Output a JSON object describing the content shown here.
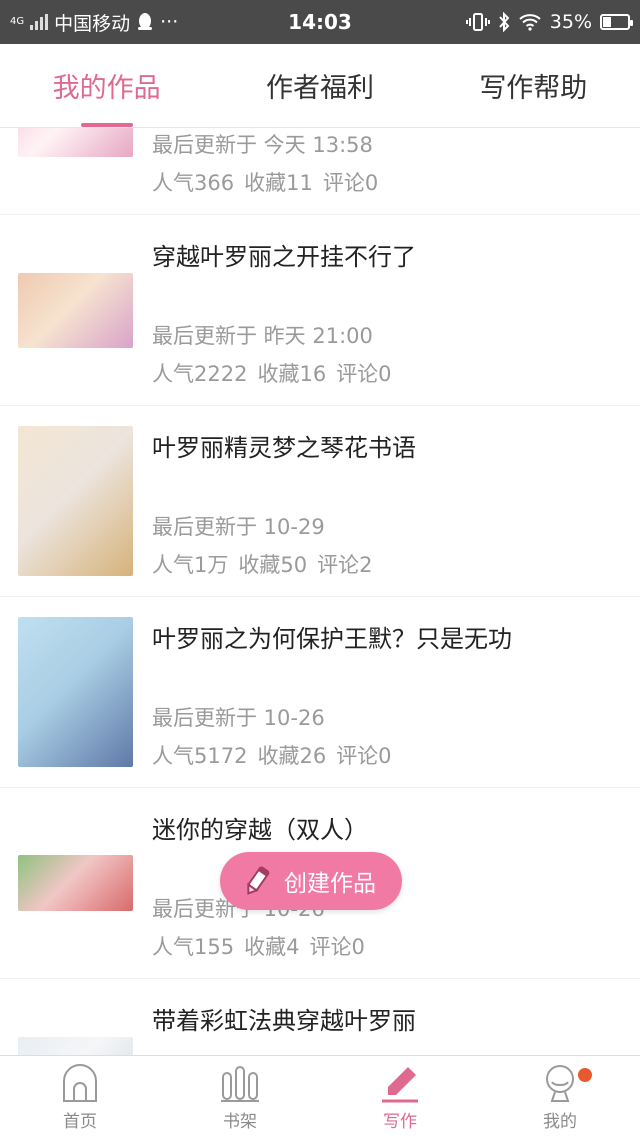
{
  "status_bar": {
    "network": "4G",
    "carrier": "中国移动",
    "more": "···",
    "time": "14:03",
    "battery": "35%",
    "battery_level": 0.35
  },
  "tabs": [
    {
      "label": "我的作品",
      "active": true
    },
    {
      "label": "作者福利",
      "active": false
    },
    {
      "label": "写作帮助",
      "active": false
    }
  ],
  "works": [
    {
      "title": "",
      "updated": "最后更新于 今天 13:58",
      "popularity": "人气366",
      "favorites": "收藏11",
      "comments": "评论0",
      "cover_colors": [
        "#f5c8d8",
        "#e7a7c2",
        "#fff3f6"
      ]
    },
    {
      "title": "穿越叶罗丽之开挂不行了",
      "updated": "最后更新于 昨天 21:00",
      "popularity": "人气2222",
      "favorites": "收藏16",
      "comments": "评论0",
      "cover_colors": [
        "#efc9b0",
        "#d9a3c9",
        "#f6e3cf"
      ]
    },
    {
      "title": "叶罗丽精灵梦之琴花书语",
      "updated": "最后更新于 10-29",
      "popularity": "人气1万",
      "favorites": "收藏50",
      "comments": "评论2",
      "cover_colors": [
        "#f3e6d2",
        "#d6b27a",
        "#ece4dd"
      ]
    },
    {
      "title": "叶罗丽之为何保护王默？只是无功",
      "updated": "最后更新于 10-26",
      "popularity": "人气5172",
      "favorites": "收藏26",
      "comments": "评论0",
      "cover_colors": [
        "#bfe0ef",
        "#5e79a8",
        "#a9cde4"
      ]
    },
    {
      "title": "迷你的穿越（双人）",
      "updated": "最后更新于 10-26",
      "popularity": "人气155",
      "favorites": "收藏4",
      "comments": "评论0",
      "cover_colors": [
        "#8fc27f",
        "#d96a6a",
        "#f2c6c6"
      ]
    },
    {
      "title": "带着彩虹法典穿越叶罗丽",
      "updated": "",
      "popularity": "",
      "favorites": "",
      "comments": "",
      "cover_colors": [
        "#e8eef2",
        "#cfd8df",
        "#f6f6f8"
      ]
    }
  ],
  "fab": {
    "label": "创建作品",
    "icon": "pencil-icon"
  },
  "bottom_nav": [
    {
      "label": "首页",
      "icon": "home-icon",
      "active": false
    },
    {
      "label": "书架",
      "icon": "bookshelf-icon",
      "active": false
    },
    {
      "label": "写作",
      "icon": "pencil-icon",
      "active": true
    },
    {
      "label": "我的",
      "icon": "profile-icon",
      "active": false,
      "badge": true
    }
  ],
  "colors": {
    "accent": "#e06a8f",
    "fab": "#f07aa3",
    "badge": "#e85a2e",
    "muted": "#9a9a9a"
  }
}
